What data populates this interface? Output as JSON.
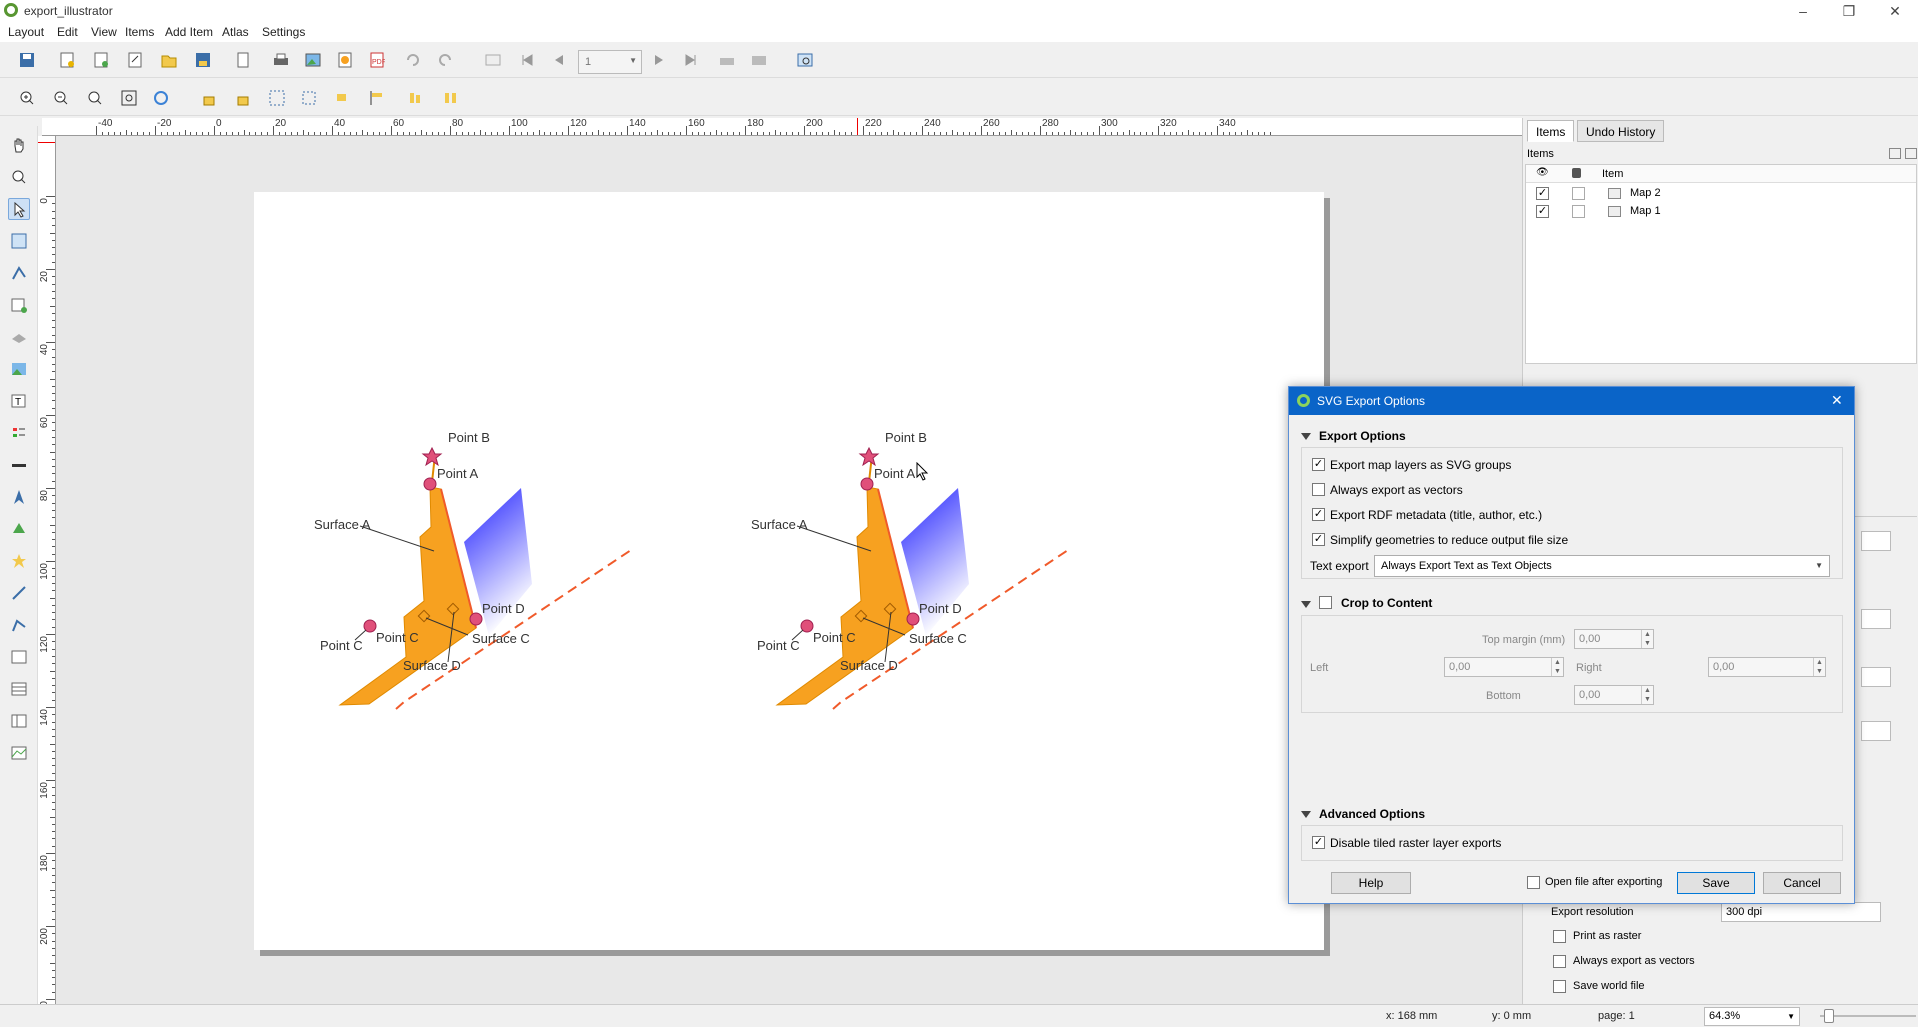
{
  "window": {
    "title": "export_illustrator"
  },
  "menu": [
    "Layout",
    "Edit",
    "View",
    "Items",
    "Add Item",
    "Atlas",
    "Settings"
  ],
  "toolbar": {
    "page_value": "1"
  },
  "ruler": {
    "h_labels": [
      "-40",
      "-20",
      "0",
      "20",
      "40",
      "60",
      "80",
      "100",
      "120",
      "140",
      "160",
      "180",
      "200",
      "220",
      "240",
      "260",
      "280",
      "300",
      "320",
      "340"
    ],
    "v_labels": [
      "0",
      "20",
      "40",
      "60",
      "80",
      "100",
      "120",
      "140",
      "160",
      "180",
      "200",
      "220"
    ]
  },
  "right_panel": {
    "tabs": [
      "Items",
      "Undo History"
    ],
    "items_label": "Items",
    "column_item": "Item",
    "items": [
      {
        "name": "Map 2",
        "visible": true,
        "locked": false
      },
      {
        "name": "Map 1",
        "visible": true,
        "locked": false
      }
    ],
    "export_resolution_label": "Export resolution",
    "export_resolution_value": "300 dpi",
    "print_as_raster": "Print as raster",
    "always_vectors": "Always export as vectors",
    "save_world_file": "Save world file"
  },
  "map": {
    "labels": [
      "Point B",
      "Point A",
      "Surface A",
      "Point C",
      "Point C",
      "Point D",
      "Surface C",
      "Surface D"
    ],
    "colors": {
      "surface": "#f7a120",
      "gradient_start": "#1a1aff",
      "gradient_end": "#ffffff",
      "point": "#e0507a",
      "line": "#f05a2a"
    }
  },
  "dialog": {
    "title": "SVG Export Options",
    "export_options": {
      "heading": "Export Options",
      "opt1": "Export map layers as SVG groups",
      "opt1_checked": true,
      "opt2": "Always export as vectors",
      "opt2_checked": false,
      "opt3": "Export RDF metadata (title, author, etc.)",
      "opt3_checked": true,
      "opt4": "Simplify geometries to reduce output file size",
      "opt4_checked": true,
      "text_export_label": "Text export",
      "text_export_value": "Always Export Text as Text Objects"
    },
    "crop": {
      "heading": "Crop to Content",
      "top_label": "Top margin (mm)",
      "top_value": "0,00",
      "left_label": "Left",
      "left_value": "0,00",
      "right_label": "Right",
      "right_value": "0,00",
      "bottom_label": "Bottom",
      "bottom_value": "0,00"
    },
    "advanced": {
      "heading": "Advanced Options",
      "opt1": "Disable tiled raster layer exports",
      "opt1_checked": true
    },
    "buttons": {
      "help": "Help",
      "open_after": "Open file after exporting",
      "save": "Save",
      "cancel": "Cancel"
    }
  },
  "status": {
    "x": "x: 168 mm",
    "y": "y: 0 mm",
    "page": "page: 1",
    "zoom": "64.3%"
  }
}
